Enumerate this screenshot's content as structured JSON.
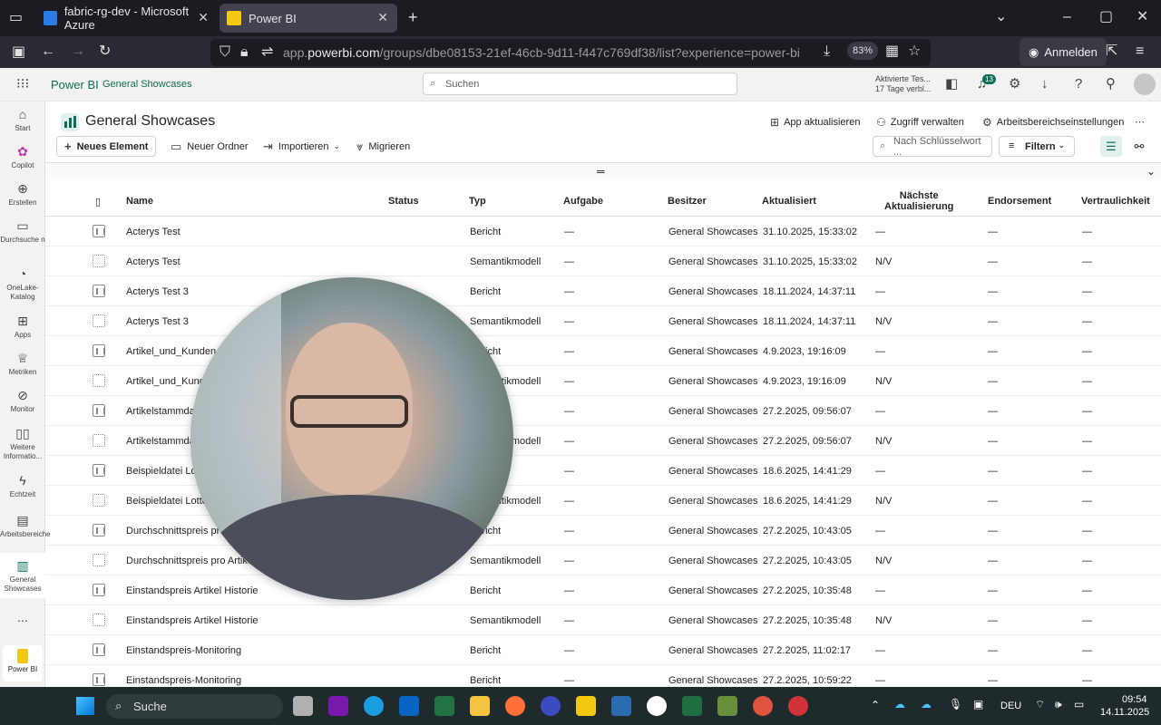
{
  "browser": {
    "tabs": [
      {
        "label": "fabric-rg-dev - Microsoft Azure",
        "active": false
      },
      {
        "label": "Power BI",
        "active": true
      }
    ],
    "url_prefix": "app.",
    "url_domain": "powerbi.com",
    "url_rest": "/groups/dbe08153-21ef-46cb-9d11-f447c769df38/list?experience=power-bi",
    "zoom": "83%",
    "signin_label": "Anmelden"
  },
  "header": {
    "brand": "Power BI",
    "workspace_crumb": "General Showcases",
    "search_placeholder": "Suchen",
    "trial_line1": "Aktivierte Tes...",
    "trial_line2": "17 Tage verbl...",
    "notification_count": "13"
  },
  "leftnav": {
    "items": [
      {
        "label": "Start",
        "icon": "home-icon"
      },
      {
        "label": "Copilot",
        "icon": "copilot-icon"
      },
      {
        "label": "Erstellen",
        "icon": "plus-circle-icon"
      },
      {
        "label": "Durchsuche n",
        "icon": "folder-icon"
      },
      {
        "label": "OneLake-Katalog",
        "icon": "onelake-icon"
      },
      {
        "label": "Apps",
        "icon": "apps-icon"
      },
      {
        "label": "Metriken",
        "icon": "trophy-icon"
      },
      {
        "label": "Monitor",
        "icon": "monitor-icon"
      },
      {
        "label": "Weitere Informatio...",
        "icon": "book-icon"
      },
      {
        "label": "Echtzeit",
        "icon": "lightning-icon"
      },
      {
        "label": "Arbeitsbereiche",
        "icon": "workspaces-icon"
      },
      {
        "label": "General Showcases",
        "icon": "workspace-icon"
      },
      {
        "label": "...",
        "icon": "more-icon"
      }
    ],
    "footer_label": "Power BI"
  },
  "workspace": {
    "title": "General Showcases",
    "update_app": "App aktualisieren",
    "manage_access": "Zugriff verwalten",
    "settings": "Arbeitsbereichseinstellungen",
    "new_item": "Neues Element",
    "new_folder": "Neuer Ordner",
    "import": "Importieren",
    "migrate": "Migrieren",
    "keyword_placeholder": "Nach Schlüsselwort ...",
    "filter": "Filtern"
  },
  "table": {
    "columns": {
      "name": "Name",
      "status": "Status",
      "type": "Typ",
      "task": "Aufgabe",
      "owner": "Besitzer",
      "updated": "Aktualisiert",
      "next_refresh_1": "Nächste",
      "next_refresh_2": "Aktualisierung",
      "endorsement": "Endorsement",
      "sensitivity": "Vertraulichkeit"
    },
    "rows": [
      {
        "kind": "report",
        "name": "Acterys Test",
        "type": "Bericht",
        "task": "—",
        "owner": "General Showcases",
        "updated": "31.10.2025, 15:33:02",
        "next": "—",
        "endorsement": "—",
        "sensitivity": "—"
      },
      {
        "kind": "model",
        "name": "Acterys Test",
        "type": "Semantikmodell",
        "task": "—",
        "owner": "General Showcases",
        "updated": "31.10.2025, 15:33:02",
        "next": "N/V",
        "endorsement": "—",
        "sensitivity": "—"
      },
      {
        "kind": "report",
        "name": "Acterys Test 3",
        "type": "Bericht",
        "task": "—",
        "owner": "General Showcases",
        "updated": "18.11.2024, 14:37:11",
        "next": "—",
        "endorsement": "—",
        "sensitivity": "—"
      },
      {
        "kind": "model",
        "name": "Acterys Test 3",
        "type": "Semantikmodell",
        "task": "—",
        "owner": "General Showcases",
        "updated": "18.11.2024, 14:37:11",
        "next": "N/V",
        "endorsement": "—",
        "sensitivity": "—"
      },
      {
        "kind": "report",
        "name": "Artikel_und_Kunden",
        "type": "Bericht",
        "task": "—",
        "owner": "General Showcases",
        "updated": "4.9.2023, 19:16:09",
        "next": "—",
        "endorsement": "—",
        "sensitivity": "—"
      },
      {
        "kind": "model",
        "name": "Artikel_und_Kunde",
        "type": "Semantikmodell",
        "task": "—",
        "owner": "General Showcases",
        "updated": "4.9.2023, 19:16:09",
        "next": "N/V",
        "endorsement": "—",
        "sensitivity": "—"
      },
      {
        "kind": "report",
        "name": "Artikelstammda",
        "type": "",
        "task": "—",
        "owner": "General Showcases",
        "updated": "27.2.2025, 09:56:07",
        "next": "—",
        "endorsement": "—",
        "sensitivity": "—"
      },
      {
        "kind": "model",
        "name": "Artikelstammda",
        "type": "Semantikmodell",
        "task": "—",
        "owner": "General Showcases",
        "updated": "27.2.2025, 09:56:07",
        "next": "N/V",
        "endorsement": "—",
        "sensitivity": "—"
      },
      {
        "kind": "report",
        "name": "Beispieldatei Lot",
        "type": "",
        "task": "—",
        "owner": "General Showcases",
        "updated": "18.6.2025, 14:41:29",
        "next": "—",
        "endorsement": "—",
        "sensitivity": "—"
      },
      {
        "kind": "model",
        "name": "Beispieldatei Lotto",
        "type": "Semantikmodell",
        "task": "—",
        "owner": "General Showcases",
        "updated": "18.6.2025, 14:41:29",
        "next": "N/V",
        "endorsement": "—",
        "sensitivity": "—"
      },
      {
        "kind": "report",
        "name": "Durchschnittspreis pro",
        "type": "Bericht",
        "task": "—",
        "owner": "General Showcases",
        "updated": "27.2.2025, 10:43:05",
        "next": "—",
        "endorsement": "—",
        "sensitivity": "—"
      },
      {
        "kind": "model",
        "name": "Durchschnittspreis pro Artikel",
        "type": "Semantikmodell",
        "task": "—",
        "owner": "General Showcases",
        "updated": "27.2.2025, 10:43:05",
        "next": "N/V",
        "endorsement": "—",
        "sensitivity": "—"
      },
      {
        "kind": "report",
        "name": "Einstandspreis Artikel Historie",
        "type": "Bericht",
        "task": "—",
        "owner": "General Showcases",
        "updated": "27.2.2025, 10:35:48",
        "next": "—",
        "endorsement": "—",
        "sensitivity": "—"
      },
      {
        "kind": "model",
        "name": "Einstandspreis Artikel Historie",
        "type": "Semantikmodell",
        "task": "—",
        "owner": "General Showcases",
        "updated": "27.2.2025, 10:35:48",
        "next": "N/V",
        "endorsement": "—",
        "sensitivity": "—"
      },
      {
        "kind": "report",
        "name": "Einstandspreis-Monitoring",
        "type": "Bericht",
        "task": "—",
        "owner": "General Showcases",
        "updated": "27.2.2025, 11:02:17",
        "next": "—",
        "endorsement": "—",
        "sensitivity": "—"
      },
      {
        "kind": "report",
        "name": "Einstandspreis-Monitoring",
        "type": "Bericht",
        "task": "—",
        "owner": "General Showcases",
        "updated": "27.2.2025, 10:59:22",
        "next": "—",
        "endorsement": "—",
        "sensitivity": "—"
      }
    ]
  },
  "taskbar": {
    "search_label": "Suche",
    "language": "DEU",
    "time": "09:54",
    "date": "14.11.2025"
  },
  "colors": {
    "brand": "#0c6e57",
    "browser_bg": "#1c1b22",
    "taskbar_bg": "#1e2a2c"
  }
}
